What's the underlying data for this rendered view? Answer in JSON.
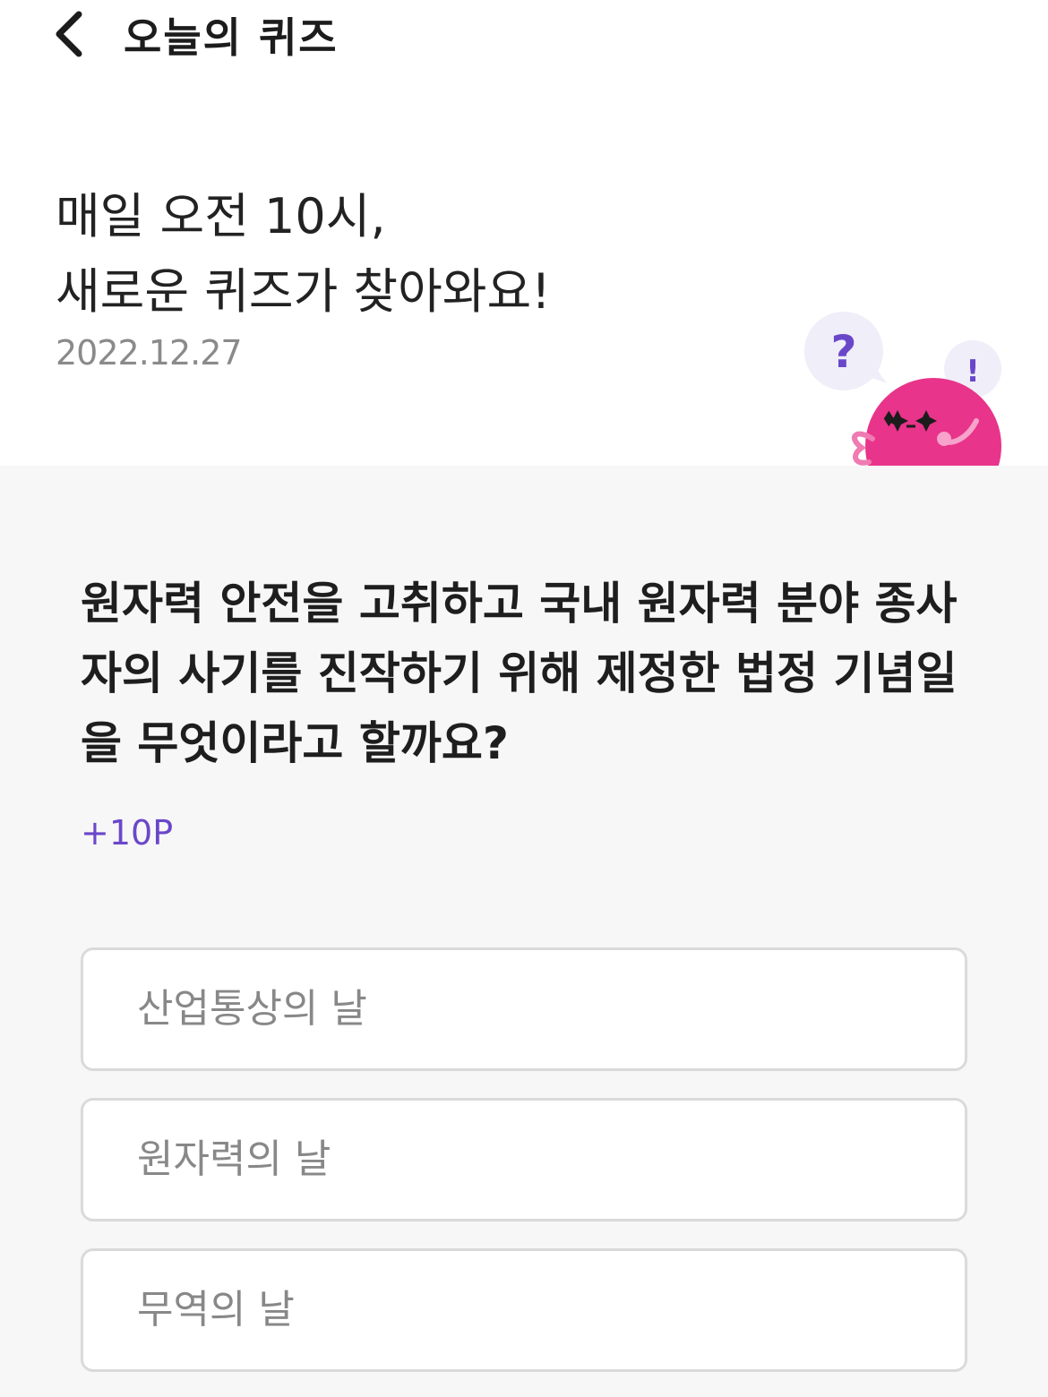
{
  "header": {
    "title": "오늘의 퀴즈",
    "back_icon": "chevron-left-icon"
  },
  "intro": {
    "line1": "매일 오전 10시,",
    "line2": "새로운 퀴즈가 찾아와요!",
    "date": "2022.12.27"
  },
  "mascot": {
    "question_mark": "?",
    "exclamation": "!",
    "body_color": "#e8348a",
    "bubble_color": "#efeef9"
  },
  "quiz": {
    "question_lines": [
      "원자력 안전을 고취하고 국내 원자력 분야 종사",
      "자의 사기를 진작하기 위해 제정한 법정 기념일",
      "을 무엇이라고 할까요?"
    ],
    "points": "+10P",
    "accent_color": "#6a47c9"
  },
  "options": [
    {
      "label": "산업통상의 날"
    },
    {
      "label": "원자력의 날"
    },
    {
      "label": "무역의 날"
    }
  ]
}
